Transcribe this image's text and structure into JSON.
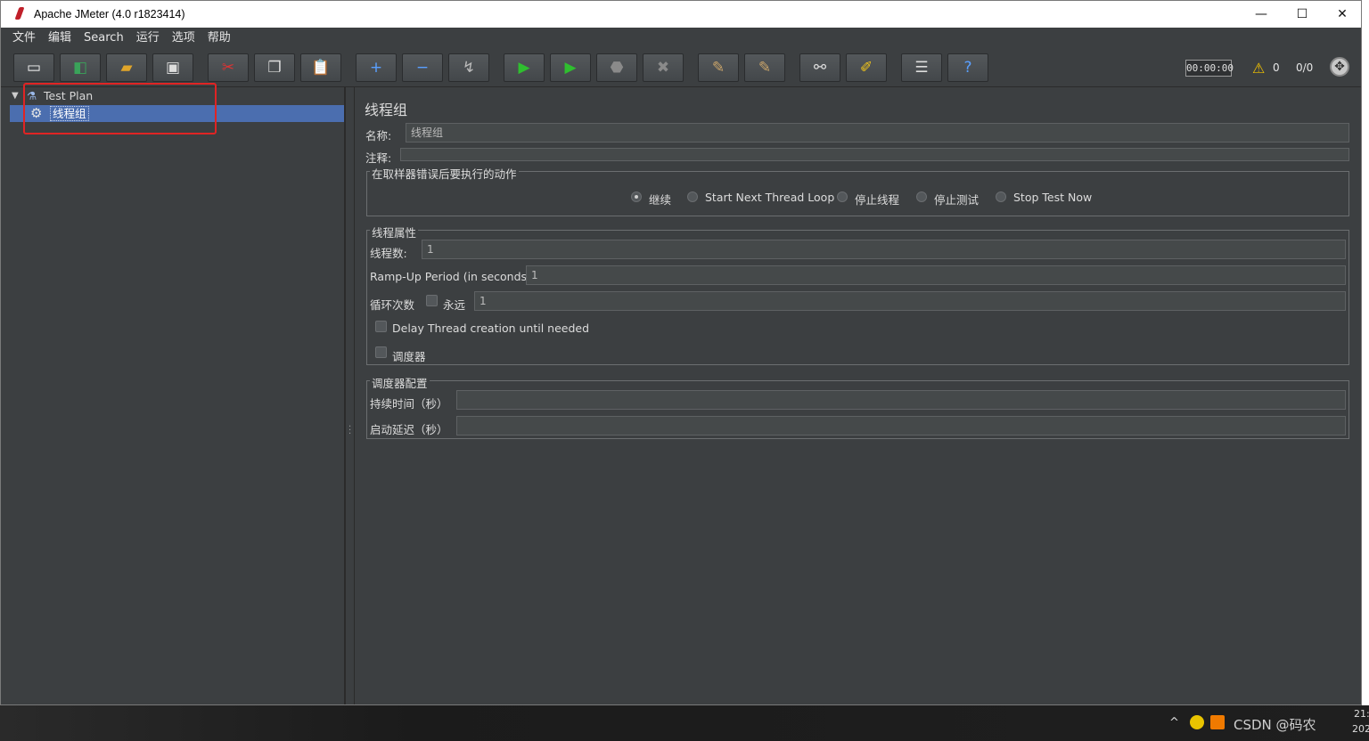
{
  "window": {
    "title": "Apache JMeter (4.0 r1823414)",
    "minimize": "—",
    "maximize": "☐",
    "close": "✕"
  },
  "menu": [
    "文件",
    "编辑",
    "Search",
    "运行",
    "选项",
    "帮助"
  ],
  "toolbar": {
    "buttons": [
      {
        "name": "new-icon",
        "glyph": "▭",
        "color": "#f5f5f5"
      },
      {
        "name": "templates-icon",
        "glyph": "◧",
        "color": "#3aa35a"
      },
      {
        "name": "open-icon",
        "glyph": "▰",
        "color": "#e0a52a"
      },
      {
        "name": "save-icon",
        "glyph": "▣",
        "color": "#dddddd"
      },
      {
        "name": "cut-icon",
        "glyph": "✂",
        "color": "#d33"
      },
      {
        "name": "copy-icon",
        "glyph": "❐",
        "color": "#dddddd"
      },
      {
        "name": "paste-icon",
        "glyph": "📋",
        "color": "#e0a52a"
      },
      {
        "name": "expand-icon",
        "glyph": "+",
        "color": "#5aa0ff"
      },
      {
        "name": "collapse-icon",
        "glyph": "−",
        "color": "#5aa0ff"
      },
      {
        "name": "toggle-icon",
        "glyph": "↯",
        "color": "#bbbbbb"
      },
      {
        "name": "start-icon",
        "glyph": "▶",
        "color": "#2fbf2f"
      },
      {
        "name": "start-no-pause-icon",
        "glyph": "▶",
        "color": "#2fbf2f"
      },
      {
        "name": "stop-icon",
        "glyph": "⬣",
        "color": "#8a8a8a"
      },
      {
        "name": "shutdown-icon",
        "glyph": "✖",
        "color": "#8a8a8a"
      },
      {
        "name": "clear-icon",
        "glyph": "✎",
        "color": "#c9a46a"
      },
      {
        "name": "clear-all-icon",
        "glyph": "✎",
        "color": "#c9a46a"
      },
      {
        "name": "search-icon",
        "glyph": "⚯",
        "color": "#dddddd"
      },
      {
        "name": "reset-search-icon",
        "glyph": "✐",
        "color": "#f0c419"
      },
      {
        "name": "function-helper-icon",
        "glyph": "☰",
        "color": "#dddddd"
      },
      {
        "name": "help-icon",
        "glyph": "?",
        "color": "#5aa0ff"
      }
    ],
    "timer": "00:00:00",
    "warnings": "0",
    "threads": "0/0"
  },
  "tree": {
    "root_label": "Test Plan",
    "child_label": "线程组"
  },
  "panel": {
    "title": "线程组",
    "name_label": "名称:",
    "name_value": "线程组",
    "comment_label": "注释:",
    "comment_value": "",
    "error_action": {
      "title": "在取样器错误后要执行的动作",
      "options": [
        "继续",
        "Start Next Thread Loop",
        "停止线程",
        "停止测试",
        "Stop Test Now"
      ],
      "selected": "继续"
    },
    "thread_props": {
      "title": "线程属性",
      "threads_label": "线程数:",
      "threads_value": "1",
      "rampup_label": "Ramp-Up Period (in seconds):",
      "rampup_value": "1",
      "loop_label": "循环次数",
      "forever_label": "永远",
      "loop_value": "1",
      "delay_label": "Delay Thread creation until needed",
      "scheduler_label": "调度器"
    },
    "scheduler": {
      "title": "调度器配置",
      "duration_label": "持续时间（秒）",
      "duration_value": "",
      "delay_label": "启动延迟（秒）",
      "delay_value": ""
    }
  },
  "taskbar": {
    "chevron": "^",
    "watermark": "CSDN @码农",
    "time": "21:",
    "date": "2021/"
  }
}
